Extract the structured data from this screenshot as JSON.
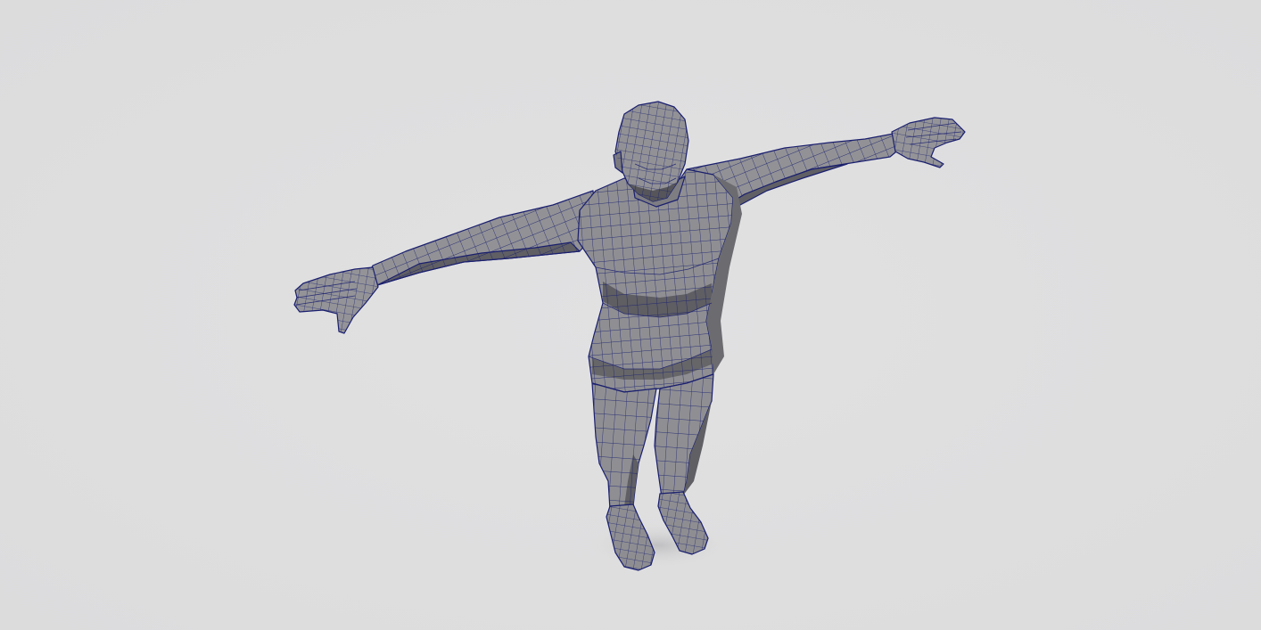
{
  "viewport": {
    "mode": "wireframe-on-shaded",
    "colors": {
      "background": "#dfdfe0",
      "mesh_fill": "#8f8f93",
      "mesh_shadow": "#5e5e63",
      "mesh_highlight": "#a7a7ab",
      "wireframe": "#1a1f6e"
    }
  },
  "model": {
    "pose": "t-pose"
  }
}
